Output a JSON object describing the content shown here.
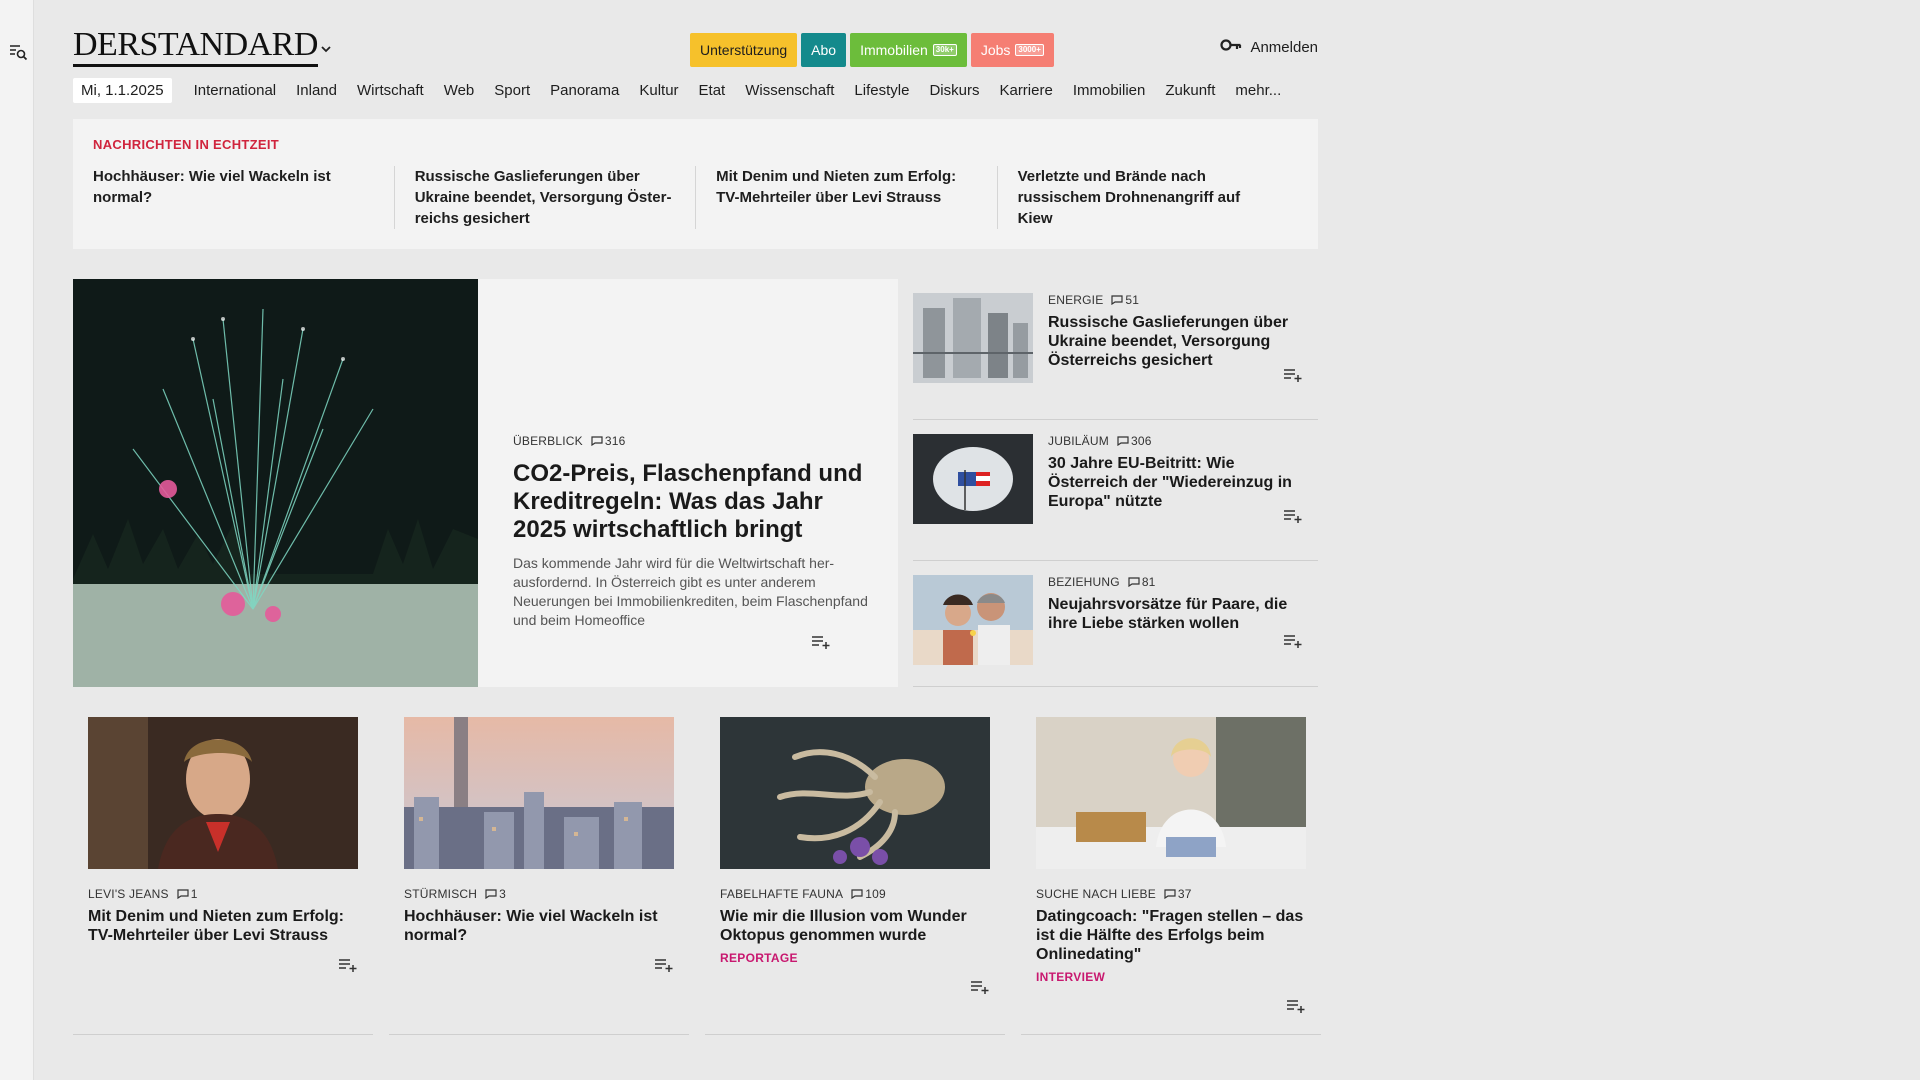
{
  "brand": {
    "logo": "DERSTANDARD",
    "colors": {
      "support": "#f6c12b",
      "abo": "#148a8c",
      "immobilien": "#6cbd3b",
      "jobs": "#f57e73",
      "live": "#d0243d",
      "tag": "#c8186f"
    }
  },
  "header": {
    "pills": {
      "support": "Unterstützung",
      "abo": "Abo",
      "immobilien": "Immobilien",
      "immobilien_badge": "30k+",
      "jobs": "Jobs",
      "jobs_badge": "3000+"
    },
    "login": "Anmelden"
  },
  "nav": {
    "date": "Mi, 1.1.2025",
    "items": [
      "International",
      "Inland",
      "Wirtschaft",
      "Web",
      "Sport",
      "Panorama",
      "Kultur",
      "Etat",
      "Wissenschaft",
      "Lifestyle",
      "Diskurs",
      "Karriere",
      "Immobilien",
      "Zukunft",
      "mehr..."
    ]
  },
  "ticker": {
    "title": "NACHRICHTEN IN ECHTZEIT",
    "items": [
      "Hochhäuser: Wie viel Wackeln ist normal?",
      "Russische Gaslieferungen über Ukraine beendet, Versorgung Öster­reichs gesichert",
      "Mit Denim und Nieten zum Erfolg: TV-Mehrteiler über Levi Strauss",
      "Verletzte und Brände nach russischem Drohnenangriff auf Kiew"
    ]
  },
  "hero": {
    "kicker": "ÜBERBLICK",
    "comments": "316",
    "title": "CO2-Preis, Flaschenpfand und Kreditregeln: Was das Jahr 2025 wirtschaftlich bringt",
    "lead": "Das kommende Jahr wird für die Weltwirtschaft her­ausfordernd. In Österreich gibt es unter anderem Neuerungen bei Immobilienkrediten, beim Flaschenpfand und beim Homeoffice"
  },
  "side": [
    {
      "kicker": "ENERGIE",
      "comments": "51",
      "title": "Russische Gaslieferungen über Ukraine beendet, Versorgung Österreichs gesichert"
    },
    {
      "kicker": "JUBILÄUM",
      "comments": "306",
      "title": "30 Jahre EU-Beitritt: Wie Österreich der \"Wiedereinzug in Europa\" nützte"
    },
    {
      "kicker": "BEZIEHUNG",
      "comments": "81",
      "title": "Neujahrsvorsätze für Paare, die ihre Liebe stärken wollen"
    }
  ],
  "cards": [
    {
      "kicker": "LEVI'S JEANS",
      "comments": "1",
      "title": "Mit Denim und Nieten zum Erfolg: TV-Mehrteiler über Levi Strauss",
      "tag": ""
    },
    {
      "kicker": "STÜRMISCH",
      "comments": "3",
      "title": "Hochhäuser: Wie viel Wackeln ist normal?",
      "tag": ""
    },
    {
      "kicker": "FABELHAFTE FAUNA",
      "comments": "109",
      "title": "Wie mir die Illusion vom Wunder Oktopus genommen wurde",
      "tag": "REPORTAGE"
    },
    {
      "kicker": "SUCHE NACH LIEBE",
      "comments": "37",
      "title": "Datingcoach: \"Fragen stellen – das ist die Hälfte des Erfolgs beim Onlinedating\"",
      "tag": "INTERVIEW"
    }
  ]
}
